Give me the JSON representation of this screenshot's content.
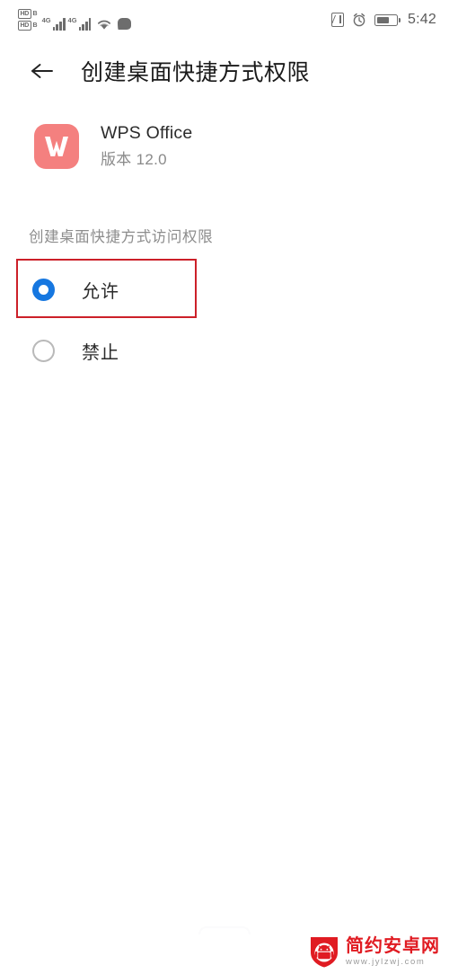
{
  "statusbar": {
    "hd_badges": [
      {
        "label": "HD",
        "sub": "B"
      },
      {
        "label": "HD",
        "sub": "B"
      }
    ],
    "signals": [
      {
        "network": "4G"
      },
      {
        "network": "4G"
      }
    ],
    "icons": [
      "wifi-icon",
      "chat-bubble-icon",
      "nfc-icon",
      "alarm-icon",
      "battery-icon"
    ],
    "time": "5:42"
  },
  "appbar": {
    "back_icon": "back-arrow-icon",
    "title": "创建桌面快捷方式权限"
  },
  "app": {
    "icon_letter": "W",
    "icon_color": "#f4807f",
    "name": "WPS Office",
    "version": "版本 12.0"
  },
  "permission": {
    "section_label": "创建桌面快捷方式访问权限",
    "options": [
      {
        "label": "允许",
        "selected": true
      },
      {
        "label": "禁止",
        "selected": false
      }
    ],
    "selected_color": "#1677e0",
    "highlight_color": "#cc2029"
  },
  "watermark": {
    "icon": "android-shield-icon",
    "title": "简约安卓网",
    "url": "www.jylzwj.com",
    "color": "#e01b22"
  }
}
